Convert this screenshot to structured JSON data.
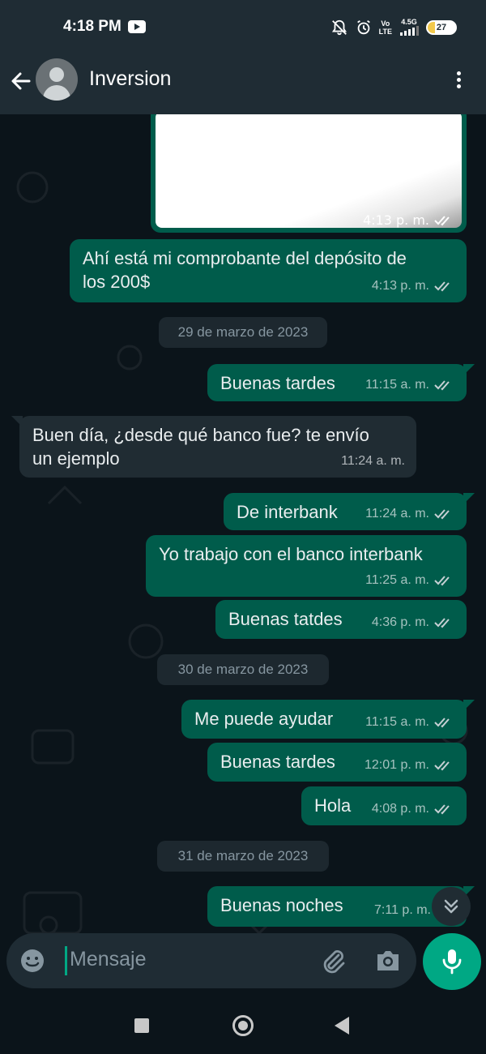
{
  "status_bar": {
    "time": "4:18 PM",
    "network_top": "Vo",
    "network_bottom": "LTE",
    "gen": "4.5G",
    "battery": "27",
    "battery_level": 0.27,
    "battery_color": "#f2c94c"
  },
  "header": {
    "contact_name": "Inversion",
    "back_icon": "arrow-left-icon",
    "more_icon": "more-vertical-icon"
  },
  "messages": [
    {
      "type": "image",
      "direction": "out",
      "time": "4:13 p. m.",
      "status": "read"
    },
    {
      "direction": "out",
      "lines": [
        "Ahí está mi comprobante del depósito de",
        "los 200$"
      ],
      "time": "4:13 p. m.",
      "status": "read"
    },
    {
      "type": "date",
      "label": "29 de marzo de 2023"
    },
    {
      "direction": "out",
      "text": "Buenas tardes",
      "time": "11:15 a. m.",
      "status": "read"
    },
    {
      "direction": "in",
      "lines": [
        "Buen día, ¿desde qué banco fue? te envío",
        "un ejemplo"
      ],
      "time": "11:24 a. m."
    },
    {
      "direction": "out",
      "text": "De interbank",
      "time": "11:24 a. m.",
      "status": "read"
    },
    {
      "direction": "out",
      "text": "Yo trabajo con el banco interbank",
      "time": "11:25 a. m.",
      "status": "read"
    },
    {
      "direction": "out",
      "text": "Buenas tatdes",
      "time": "4:36 p. m.",
      "status": "read"
    },
    {
      "type": "date",
      "label": "30 de marzo de 2023"
    },
    {
      "direction": "out",
      "text": "Me puede ayudar",
      "time": "11:15 a. m.",
      "status": "read"
    },
    {
      "direction": "out",
      "text": "Buenas tardes",
      "time": "12:01 p. m.",
      "status": "read"
    },
    {
      "direction": "out",
      "text": "Hola",
      "time": "4:08 p. m.",
      "status": "read"
    },
    {
      "type": "date",
      "label": "31 de marzo de 2023"
    },
    {
      "direction": "out",
      "text": "Buenas noches",
      "time": "7:11 p. m."
    }
  ],
  "composer": {
    "placeholder": "Mensaje",
    "emoji_icon": "emoji-icon",
    "attach_icon": "paperclip-icon",
    "camera_icon": "camera-icon",
    "mic_icon": "microphone-icon"
  },
  "colors": {
    "outgoing_bubble": "#005c4b",
    "incoming_bubble": "#202c33",
    "accent": "#00a884",
    "background": "#0b141a"
  }
}
